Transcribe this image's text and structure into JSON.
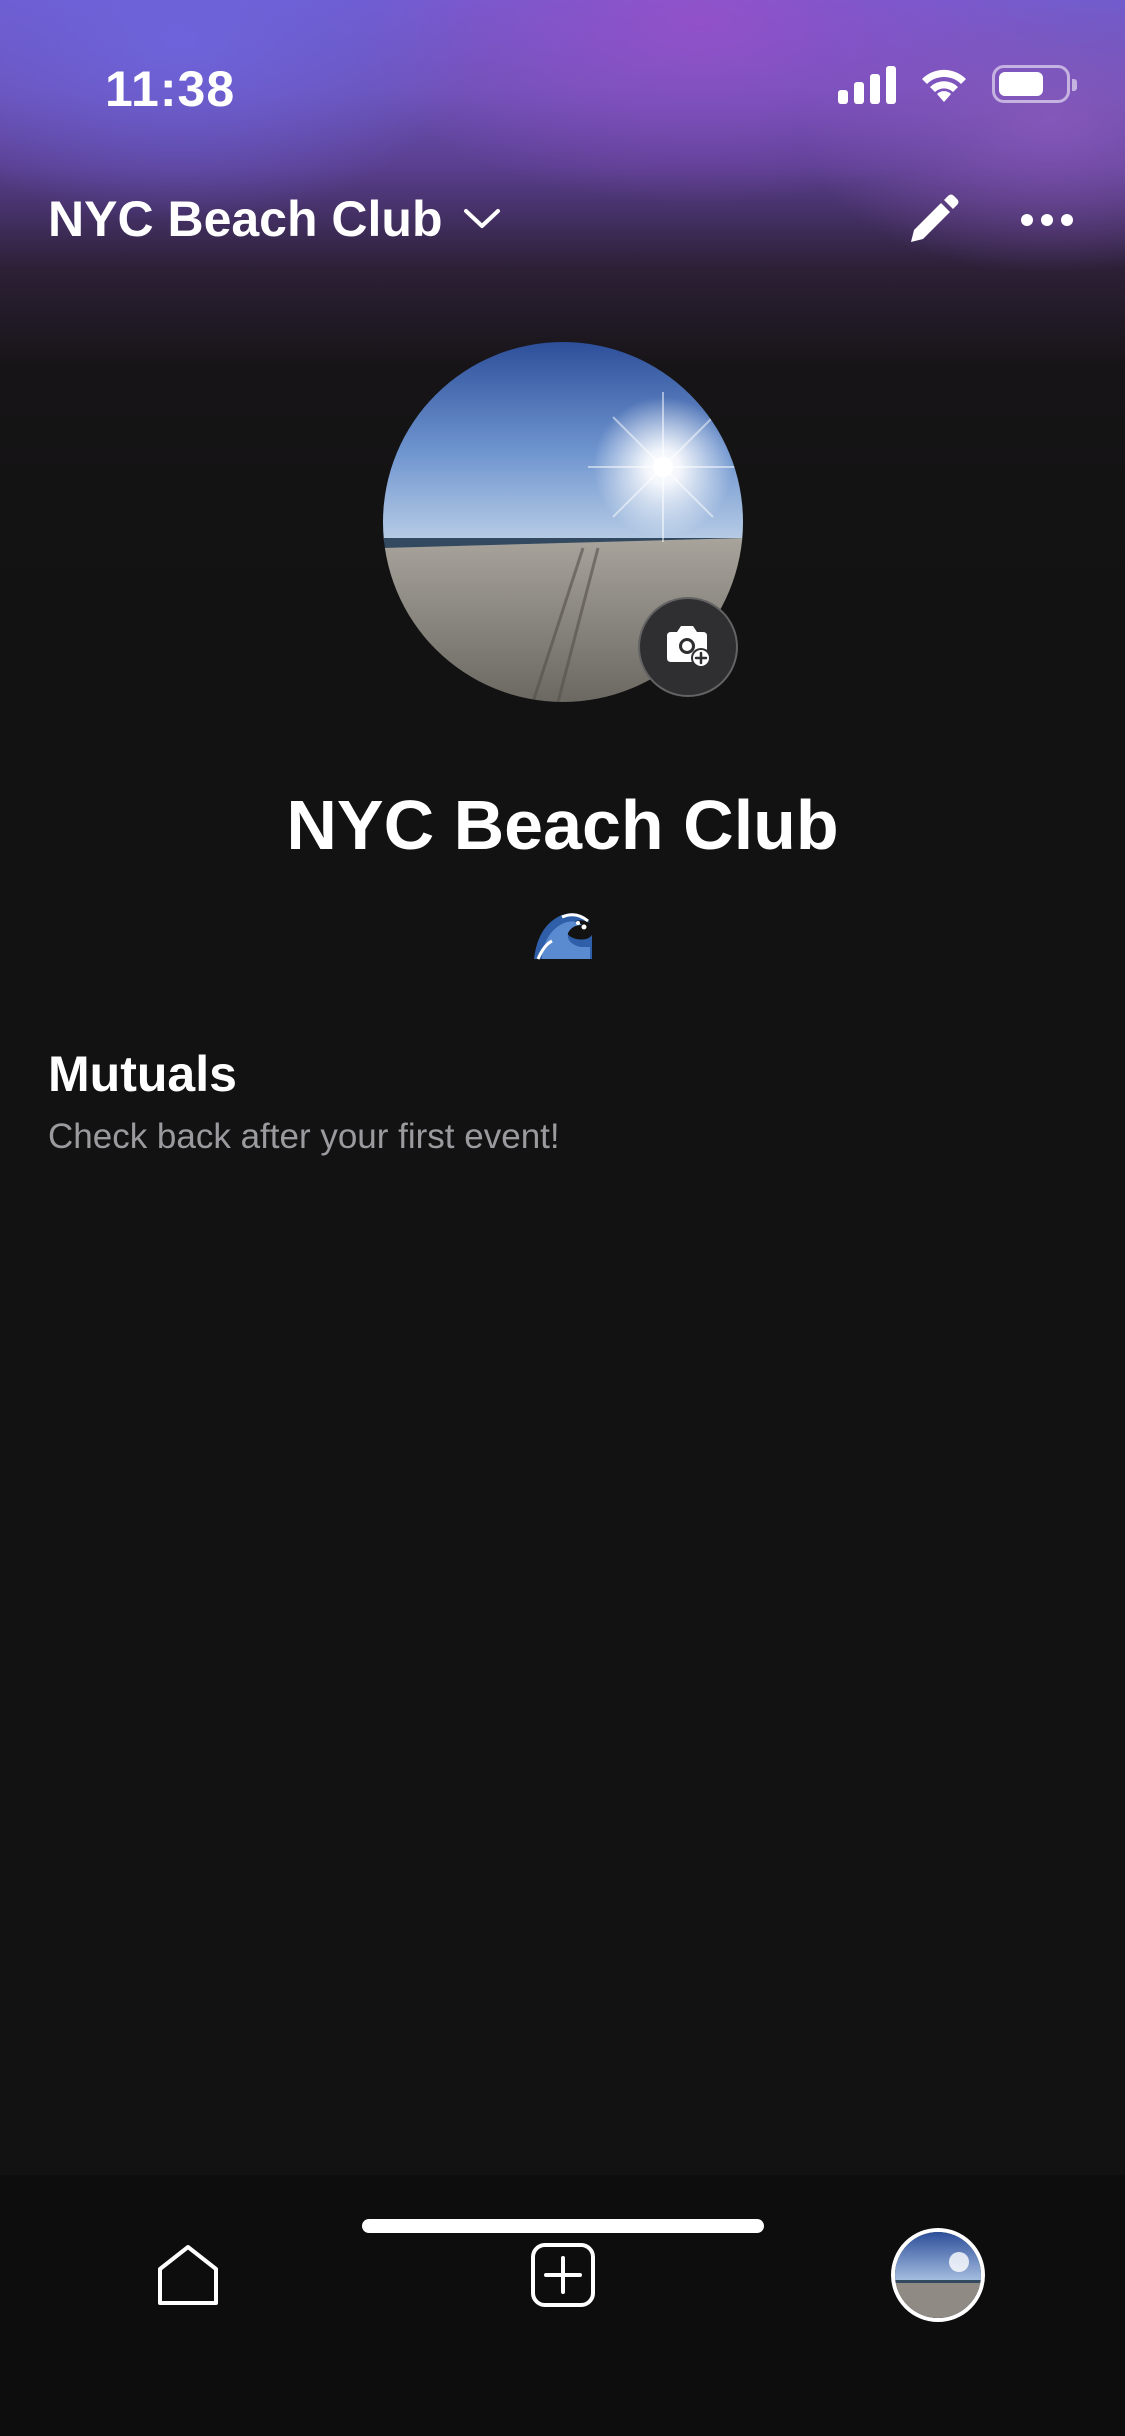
{
  "status_bar": {
    "time": "11:38"
  },
  "header": {
    "title": "NYC Beach Club"
  },
  "profile": {
    "name": "NYC Beach Club",
    "emoji": "🌊"
  },
  "mutuals": {
    "title": "Mutuals",
    "subtitle": "Check back after your first event!"
  },
  "tab_bar": {
    "items": [
      {
        "icon": "home-icon"
      },
      {
        "icon": "add-square-icon"
      },
      {
        "icon": "profile-avatar"
      }
    ]
  },
  "colors": {
    "background": "#121212",
    "gradient_top": "#6d5ccf",
    "secondary_text": "#9b9b9f",
    "camera_button": "#2f2f31"
  }
}
